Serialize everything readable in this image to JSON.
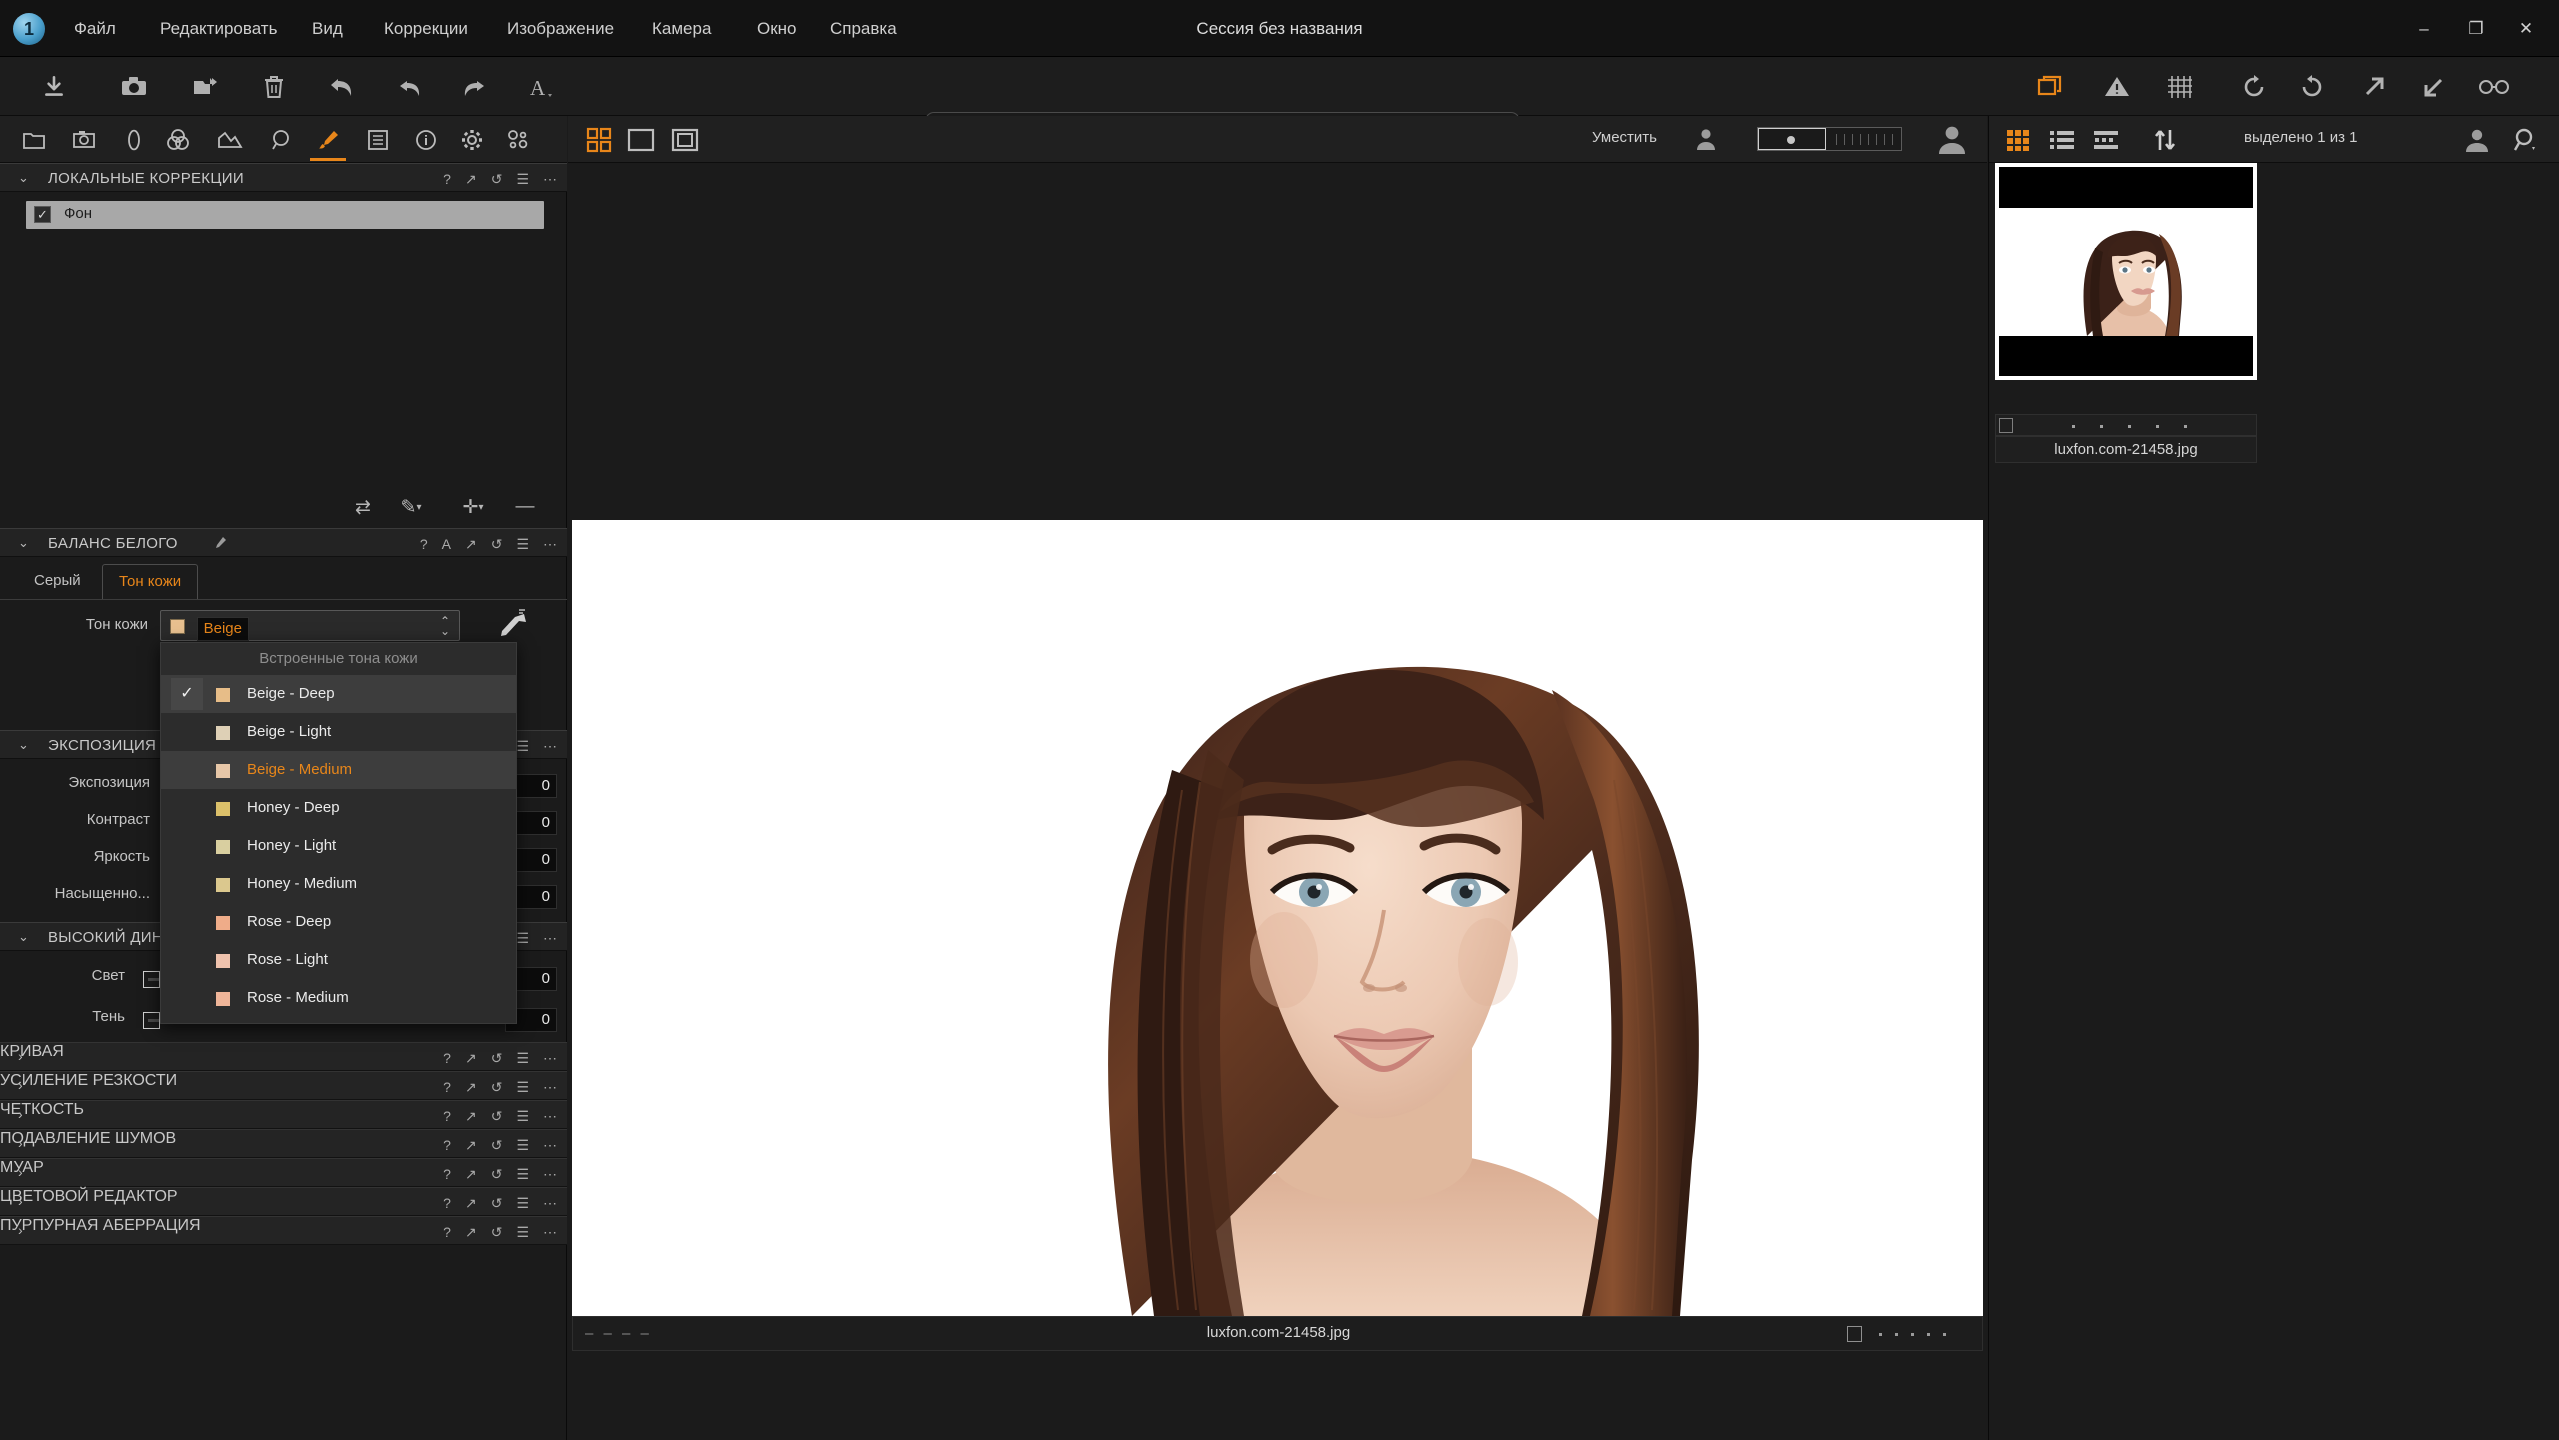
{
  "window": {
    "title": "Сессия без названия",
    "app_badge": "1",
    "controls": {
      "minimize": "–",
      "maximize": "❐",
      "close": "✕"
    }
  },
  "menubar": [
    {
      "label": "Файл"
    },
    {
      "label": "Редактировать"
    },
    {
      "label": "Вид"
    },
    {
      "label": "Коррекции"
    },
    {
      "label": "Изображение"
    },
    {
      "label": "Камера"
    },
    {
      "label": "Окно"
    },
    {
      "label": "Справка"
    }
  ],
  "toolbar_left": [
    {
      "name": "import-icon"
    },
    {
      "name": "camera-icon"
    },
    {
      "name": "open-folder-icon"
    },
    {
      "name": "trash-icon"
    },
    {
      "name": "undo-all-icon"
    },
    {
      "name": "undo-icon"
    },
    {
      "name": "redo-icon"
    },
    {
      "name": "annotate-text-icon"
    }
  ],
  "toolbar_center": [
    {
      "name": "select-cursor-tool"
    },
    {
      "name": "pan-hand-tool"
    },
    {
      "name": "keystone-tool"
    },
    {
      "name": "crop-tool"
    },
    {
      "name": "rotate-tool"
    },
    {
      "name": "straighten-tool"
    },
    {
      "name": "spot-removal-tool"
    },
    {
      "name": "local-brush-tool"
    },
    {
      "name": "eyedropper-tool"
    },
    {
      "name": "skin-tone-picker-tool"
    }
  ],
  "toolbar_right": [
    {
      "name": "variants-icon"
    },
    {
      "name": "warning-icon"
    },
    {
      "name": "grid-overlay-icon"
    },
    {
      "name": "rotate-left-icon"
    },
    {
      "name": "rotate-right-icon"
    },
    {
      "name": "arrow-up-right-icon"
    },
    {
      "name": "arrow-down-left-icon"
    },
    {
      "name": "glasses-icon"
    }
  ],
  "left_panel": {
    "tabs": [
      {
        "name": "library-tab"
      },
      {
        "name": "capture-tab"
      },
      {
        "name": "lens-tab"
      },
      {
        "name": "color-tab"
      },
      {
        "name": "exposure-tab"
      },
      {
        "name": "details-tab"
      },
      {
        "name": "local-adjustments-tab",
        "active": true
      },
      {
        "name": "metadata-tab"
      },
      {
        "name": "info-tab"
      },
      {
        "name": "settings-tab"
      },
      {
        "name": "batch-tab"
      }
    ],
    "local_adjustments": {
      "title": "ЛОКАЛЬНЫЕ КОРРЕКЦИИ",
      "layers": [
        {
          "name": "Фон",
          "checked": true
        }
      ],
      "mini_tools": [
        "invert-mask-icon",
        "brush-icon",
        "add-layer-icon",
        "remove-layer-icon"
      ]
    },
    "white_balance": {
      "title": "БАЛАНС БЕЛОГО",
      "tabs": [
        {
          "label": "Серый",
          "active": false
        },
        {
          "label": "Тон кожи",
          "active": true
        }
      ],
      "field_label": "Тон кожи",
      "selected_value": "Beige - Deep",
      "selected_swatch": "#e8c08f",
      "dropdown": {
        "header": "Встроенные тона кожи",
        "items": [
          {
            "label": "Beige - Deep",
            "swatch": "#e7bd88",
            "checked": true,
            "highlighted": false
          },
          {
            "label": "Beige - Light",
            "swatch": "#ded0b6",
            "checked": false,
            "highlighted": false
          },
          {
            "label": "Beige - Medium",
            "swatch": "#e7c7a8",
            "checked": false,
            "highlighted": true
          },
          {
            "label": "Honey - Deep",
            "swatch": "#dbc06a",
            "checked": false,
            "highlighted": false
          },
          {
            "label": "Honey - Light",
            "swatch": "#d9cfa0",
            "checked": false,
            "highlighted": false
          },
          {
            "label": "Honey - Medium",
            "swatch": "#dbc88e",
            "checked": false,
            "highlighted": false
          },
          {
            "label": "Rose - Deep",
            "swatch": "#efac89",
            "checked": false,
            "highlighted": false
          },
          {
            "label": "Rose - Light",
            "swatch": "#efc2ad",
            "checked": false,
            "highlighted": false
          },
          {
            "label": "Rose - Medium",
            "swatch": "#efb599",
            "checked": false,
            "highlighted": false
          }
        ]
      }
    },
    "exposure": {
      "title": "ЭКСПОЗИЦИЯ",
      "sliders": [
        {
          "label": "Экспозиция",
          "value": "0"
        },
        {
          "label": "Контраст",
          "value": "0"
        },
        {
          "label": "Яркость",
          "value": "0"
        },
        {
          "label": "Насыщенно...",
          "value": "0"
        }
      ]
    },
    "hdr": {
      "title": "ВЫСОКИЙ ДИНАМИЧЕСКИЙ ДИАПАЗОН",
      "sliders": [
        {
          "label": "Свет",
          "value": "0"
        },
        {
          "label": "Тень",
          "value": "0"
        }
      ]
    },
    "collapsed_sections": [
      {
        "title": "КРИВАЯ"
      },
      {
        "title": "УСИЛЕНИЕ РЕЗКОСТИ"
      },
      {
        "title": "ЧЕТКОСТЬ"
      },
      {
        "title": "ПОДАВЛЕНИЕ ШУМОВ"
      },
      {
        "title": "МУАР"
      },
      {
        "title": "ЦВЕТОВОЙ РЕДАКТОР"
      },
      {
        "title": "ПУРПУРНАЯ АБЕРРАЦИЯ"
      }
    ],
    "header_icons": [
      "help-icon",
      "auto-icon",
      "expand-icon",
      "reset-icon",
      "presets-icon",
      "more-icon"
    ]
  },
  "viewer": {
    "view_modes": [
      "multi-view-icon",
      "single-view-icon",
      "proof-view-icon"
    ],
    "fit_label": "Уместить",
    "zoom_ticks": 9,
    "status": {
      "dashes": "– – – –",
      "filename": "luxfon.com-21458.jpg",
      "dots": 5
    }
  },
  "browser": {
    "view_icons": [
      "grid-view-icon",
      "list-view-icon",
      "filmstrip-view-icon"
    ],
    "sort_icon": "sort-icon",
    "selection_label": "выделено 1 из 1",
    "right_icons": [
      "person-icon",
      "search-icon"
    ],
    "thumbnail": {
      "filename": "luxfon.com-21458.jpg",
      "rating_dots": 5
    }
  },
  "colors": {
    "accent": "#e8861a",
    "panel_bg": "#1b1b1b",
    "header_bg": "#232323",
    "text": "#c8c8c8"
  }
}
